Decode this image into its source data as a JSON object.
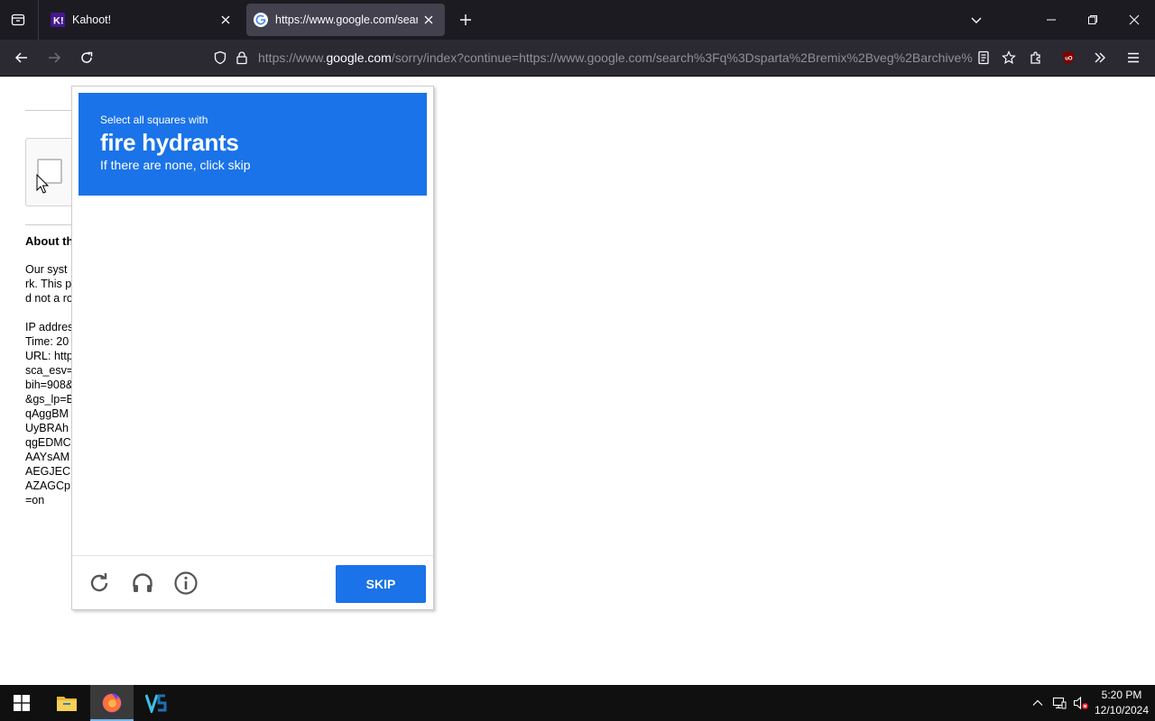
{
  "browser": {
    "tabs": [
      {
        "title": "Kahoot!",
        "favicon": "kahoot-icon",
        "active": false
      },
      {
        "title": "https://www.google.com/search?q=sparta+remix",
        "favicon": "google-icon",
        "active": true
      }
    ],
    "url": {
      "prefix": "https://www.",
      "host": "google.com",
      "rest": "/sorry/index?continue=https://www.google.com/search%3Fq%3Dsparta%2Bremix%2Bveg%2Barchive%"
    }
  },
  "page": {
    "about_heading": "About this page",
    "info_lines": [
      "Our syst",
      "rk. This p",
      "d not a ro",
      "",
      "IP addres",
      "Time: 20",
      "URL: http",
      "sca_esv=",
      "bih=908&",
      "&gs_lp=E",
      "qAggBM",
      "UyBRAh",
      "qgEDMC",
      "AAYsAM",
      "AEGJEC",
      "AZAGCp",
      "=on"
    ]
  },
  "captcha": {
    "instruction": "Select all squares with",
    "target": "fire hydrants",
    "hint": "If there are none, click skip",
    "skip_label": "SKIP",
    "accent_color": "#1a73e8"
  },
  "taskbar": {
    "time": "5:20 PM",
    "date": "12/10/2024"
  }
}
